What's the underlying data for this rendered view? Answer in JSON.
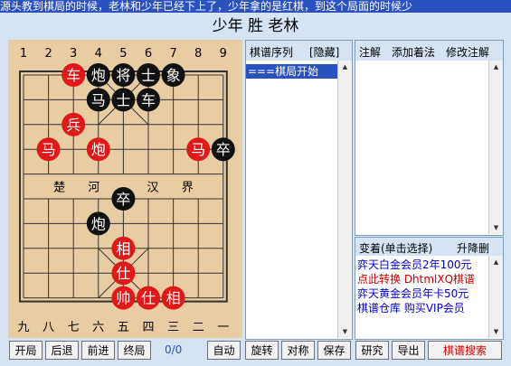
{
  "top_marquee": "源头教到棋局的时候，老林和少年已经下上了，少年拿的是红棋，到这个局面的时候少",
  "title": "少年 胜 老林",
  "board": {
    "top_numbers": [
      "1",
      "2",
      "3",
      "4",
      "5",
      "6",
      "7",
      "8",
      "9"
    ],
    "bottom_numbers": [
      "九",
      "八",
      "七",
      "六",
      "五",
      "四",
      "三",
      "二",
      "一"
    ],
    "river_text": [
      "楚",
      "河",
      "汉",
      "界"
    ],
    "pieces": [
      {
        "col": 2,
        "row": 0,
        "label": "车",
        "color": "red"
      },
      {
        "col": 3,
        "row": 0,
        "label": "炮",
        "color": "black"
      },
      {
        "col": 4,
        "row": 0,
        "label": "将",
        "color": "black"
      },
      {
        "col": 5,
        "row": 0,
        "label": "士",
        "color": "black"
      },
      {
        "col": 6,
        "row": 0,
        "label": "象",
        "color": "black"
      },
      {
        "col": 3,
        "row": 1,
        "label": "马",
        "color": "black"
      },
      {
        "col": 4,
        "row": 1,
        "label": "士",
        "color": "black"
      },
      {
        "col": 5,
        "row": 1,
        "label": "车",
        "color": "black"
      },
      {
        "col": 2,
        "row": 2,
        "label": "兵",
        "color": "red"
      },
      {
        "col": 1,
        "row": 3,
        "label": "马",
        "color": "red"
      },
      {
        "col": 3,
        "row": 3,
        "label": "炮",
        "color": "red"
      },
      {
        "col": 7,
        "row": 3,
        "label": "马",
        "color": "red"
      },
      {
        "col": 8,
        "row": 3,
        "label": "卒",
        "color": "black"
      },
      {
        "col": 4,
        "row": 5,
        "label": "卒",
        "color": "black"
      },
      {
        "col": 3,
        "row": 6,
        "label": "炮",
        "color": "black"
      },
      {
        "col": 4,
        "row": 7,
        "label": "相",
        "color": "red"
      },
      {
        "col": 4,
        "row": 8,
        "label": "仕",
        "color": "red"
      },
      {
        "col": 4,
        "row": 9,
        "label": "帅",
        "color": "red"
      },
      {
        "col": 5,
        "row": 9,
        "label": "仕",
        "color": "red"
      },
      {
        "col": 6,
        "row": 9,
        "label": "相",
        "color": "red"
      }
    ]
  },
  "move_list": {
    "header": "棋谱序列",
    "toggle": "[隐藏]",
    "items": [
      "===棋局开始"
    ]
  },
  "comment": {
    "header_items": [
      "注解",
      "添加着法",
      "修改注解"
    ]
  },
  "variations": {
    "header": "变着(单击选择)",
    "delete": "升降删",
    "ads": [
      {
        "text": "弈天白金会员2年100元",
        "color": "#0000cc"
      },
      {
        "text": "点此转换 DhtmlXQ棋谱",
        "color": "#cc0000"
      },
      {
        "text": "弈天黄金会员年卡50元",
        "color": "#0000cc"
      },
      {
        "text": "棋谱仓库 购买VIP会员",
        "color": "#0000cc"
      }
    ]
  },
  "toolbar": {
    "open": "开局",
    "back": "后退",
    "forward": "前进",
    "end": "终局",
    "counter": "0/0",
    "auto": "自动",
    "rotate": "旋转",
    "mirror": "对称",
    "save": "保存",
    "study": "研究",
    "export": "导出",
    "search": "棋谱搜索"
  },
  "colors": {
    "board": "#e8cda2",
    "red_piece": "#e01818",
    "black_piece": "#111111",
    "accent_blue": "#2a52be",
    "panel_bg": "#d5e3f2"
  }
}
